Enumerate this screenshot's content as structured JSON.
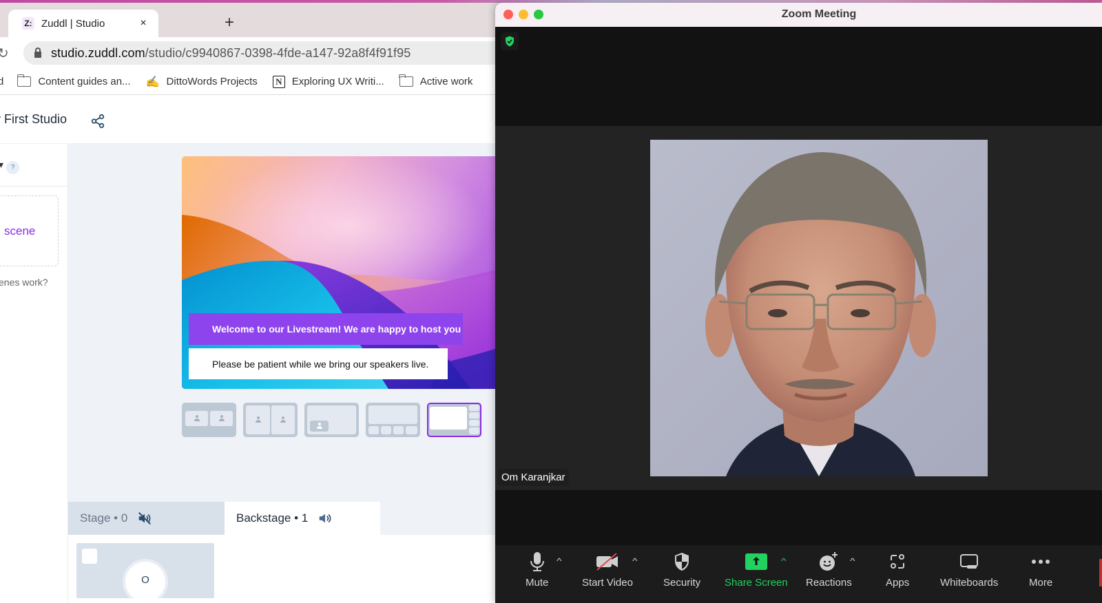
{
  "browser": {
    "tab": {
      "favicon": "Z:",
      "title": "Zuddl | Studio",
      "close_icon": "×"
    },
    "new_tab_icon": "+",
    "reload_icon": "↻",
    "url_host": "studio.zuddl.com",
    "url_path": "/studio/c9940867-0398-4fde-a147-92a8f4f91f95",
    "bookmarks": [
      {
        "icon": "folder-icon",
        "label": "Content guides an..."
      },
      {
        "icon": "pen-icon",
        "label": "DittoWords Projects"
      },
      {
        "icon": "notion-icon",
        "label": "Exploring UX Writi..."
      },
      {
        "icon": "folder-icon",
        "label": "Active work"
      }
    ],
    "bookmark_partial": "d"
  },
  "studio": {
    "title": "y First Studio",
    "sidebar": {
      "header_caret": "▾",
      "help_label": "?",
      "add_scene_label": "scene",
      "scenes_help_link": "enes work?"
    },
    "preview": {
      "banner_primary": "Welcome to our Livestream! We are happy to host you",
      "banner_secondary": "Please be patient while we bring our speakers live."
    },
    "layouts": [
      {
        "name": "two-up-grid",
        "selected": false
      },
      {
        "name": "two-up-split",
        "selected": false
      },
      {
        "name": "picture-in-picture",
        "selected": false
      },
      {
        "name": "main-with-bottom-strip",
        "selected": false
      },
      {
        "name": "main-with-side-strip",
        "selected": true
      }
    ],
    "stage_tabs": [
      {
        "label": "Stage • 0",
        "audio": "muted"
      },
      {
        "label": "Backstage • 1",
        "audio": "on"
      }
    ],
    "backstage_participant": {
      "initial": "O"
    },
    "accent_color": "#8a2be2"
  },
  "zoom": {
    "window_title": "Zoom Meeting",
    "participant_name": "Om Karanjkar",
    "controls": [
      {
        "label": "Mute",
        "icon": "microphone-icon",
        "has_menu": true
      },
      {
        "label": "Start Video",
        "icon": "video-off-icon",
        "has_menu": true
      },
      {
        "label": "Security",
        "icon": "security-shield-icon",
        "has_menu": false
      },
      {
        "label": "Share Screen",
        "icon": "share-screen-icon",
        "has_menu": true
      },
      {
        "label": "Reactions",
        "icon": "reactions-icon",
        "has_menu": true
      },
      {
        "label": "Apps",
        "icon": "apps-icon",
        "has_menu": false
      },
      {
        "label": "Whiteboards",
        "icon": "whiteboard-icon",
        "has_menu": false
      },
      {
        "label": "More",
        "icon": "more-icon",
        "has_menu": false
      }
    ],
    "caret_glyph": "^",
    "share_color": "#23d160"
  }
}
